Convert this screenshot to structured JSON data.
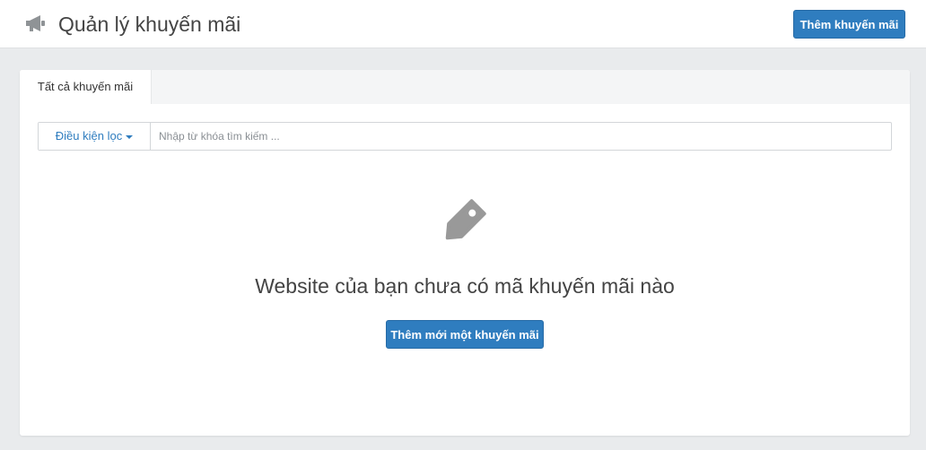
{
  "header": {
    "icon": "megaphone-icon",
    "title": "Quản lý khuyến mãi",
    "add_button_label": "Thêm khuyến mãi"
  },
  "tabs": [
    {
      "label": "Tất cả khuyến mãi",
      "active": true
    }
  ],
  "filter": {
    "filter_button_label": "Điều kiện lọc",
    "search_placeholder": "Nhập từ khóa tìm kiếm ..."
  },
  "empty_state": {
    "icon": "tag-icon",
    "message": "Website của bạn chưa có mã khuyến mãi nào",
    "button_label": "Thêm mới một khuyến mãi"
  },
  "colors": {
    "primary": "#2f7dbf",
    "background": "#e9ebed",
    "icon_gray": "#999999"
  }
}
